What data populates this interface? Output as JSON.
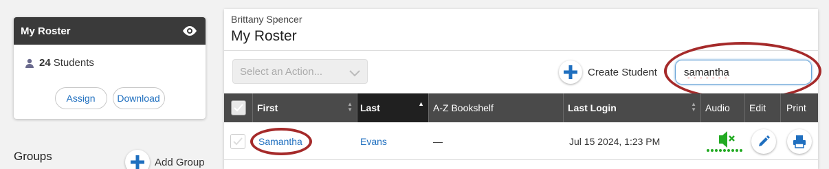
{
  "roster_card": {
    "title": "My Roster",
    "student_count": "24",
    "student_label": "Students",
    "assign_label": "Assign",
    "download_label": "Download"
  },
  "groups": {
    "title": "Groups",
    "add_label": "Add Group"
  },
  "main": {
    "teacher_name": "Brittany Spencer",
    "title": "My Roster",
    "action_placeholder": "Select an Action...",
    "create_label": "Create Student",
    "search_value": "samantha"
  },
  "table": {
    "headers": {
      "first": "First",
      "last": "Last",
      "bookshelf": "A-Z Bookshelf",
      "last_login": "Last Login",
      "audio": "Audio",
      "edit": "Edit",
      "print": "Print"
    },
    "rows": [
      {
        "first": "Samantha",
        "last": "Evans",
        "bookshelf": "—",
        "last_login": "Jul 15 2024, 1:23 PM"
      }
    ]
  },
  "colors": {
    "accent": "#1f6fbf",
    "annotation": "#a52a2a",
    "audio_green": "#22aa22",
    "header_dark": "#4a4a4a"
  },
  "icons": [
    "eye-icon",
    "person-icon",
    "plus-icon",
    "chevron-down-icon",
    "checkmark-icon",
    "audio-muted-icon",
    "pencil-icon",
    "printer-icon"
  ]
}
